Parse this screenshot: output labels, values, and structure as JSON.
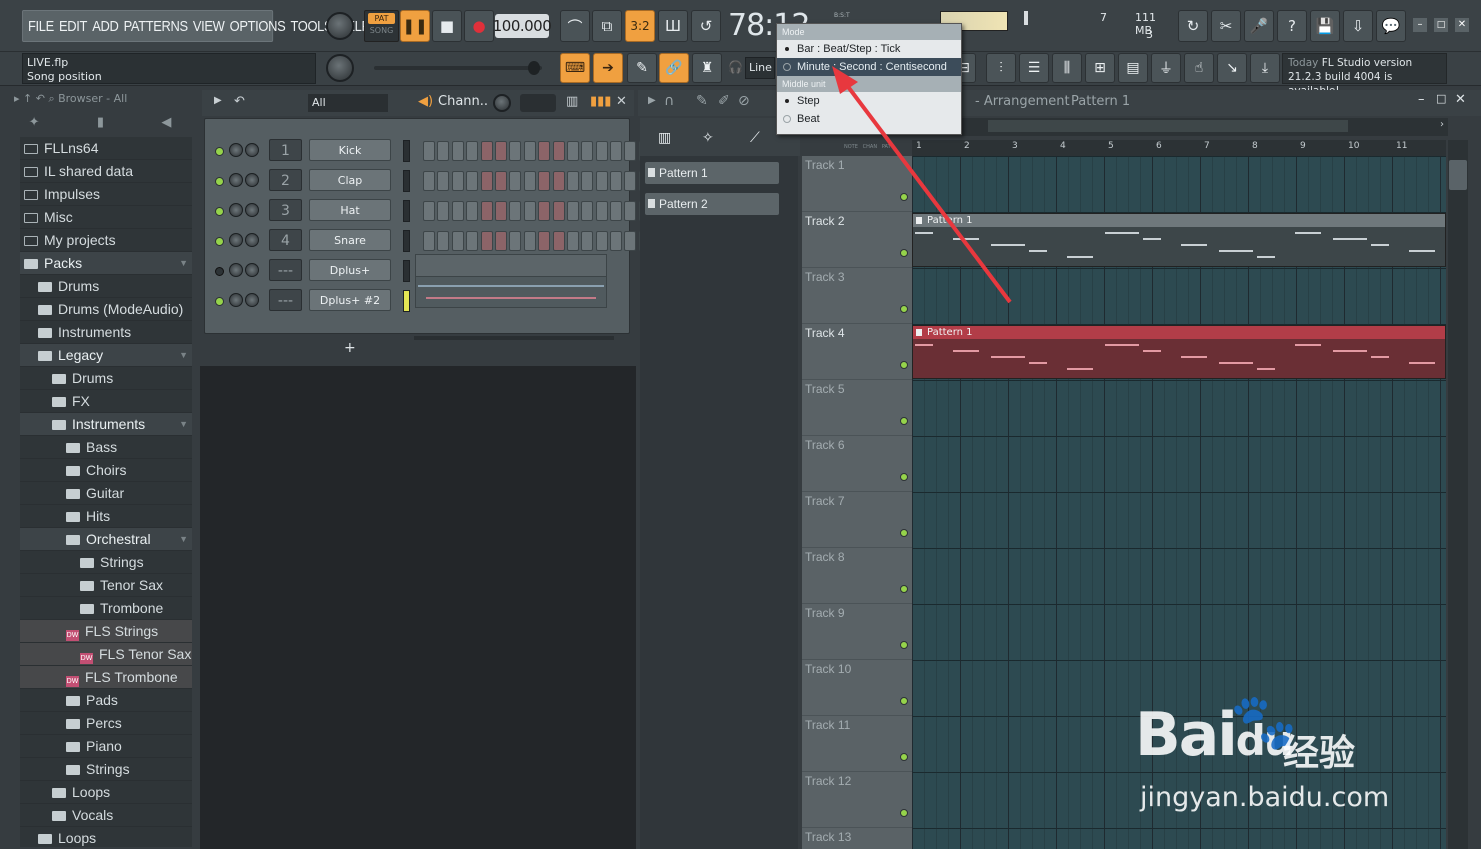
{
  "menu": [
    "FILE",
    "EDIT",
    "ADD",
    "PATTERNS",
    "VIEW",
    "OPTIONS",
    "TOOLS",
    "HELP"
  ],
  "transport": {
    "pat": "PAT",
    "song": "SONG",
    "tempo": "100.000",
    "time": "78:12",
    "bst": "B:S:T"
  },
  "status": {
    "cpu_left": "7",
    "memory": "111 MB",
    "poly": "3"
  },
  "hint": {
    "file": "LIVE.flp",
    "label": "Song position"
  },
  "snap": "Line",
  "news": {
    "today": "Today",
    "title": "FL Studio version",
    "body": "21.2.3 build 4004 is available!"
  },
  "browser": {
    "title": "Browser - All",
    "items": [
      {
        "label": "FLLns64",
        "icon": "folder-icon",
        "indent": 0
      },
      {
        "label": "IL shared data",
        "icon": "folder-icon",
        "indent": 0
      },
      {
        "label": "Impulses",
        "icon": "folder-icon",
        "indent": 0
      },
      {
        "label": "Misc",
        "icon": "folder-icon",
        "indent": 0
      },
      {
        "label": "My projects",
        "icon": "folder-icon",
        "indent": 0
      },
      {
        "label": "Packs",
        "icon": "pack-icon",
        "indent": 0
      },
      {
        "label": "Drums",
        "icon": "pack-icon",
        "indent": 1
      },
      {
        "label": "Drums (ModeAudio)",
        "icon": "pack-icon",
        "indent": 1
      },
      {
        "label": "Instruments",
        "icon": "pack-icon",
        "indent": 1
      },
      {
        "label": "Legacy",
        "icon": "pack-icon",
        "indent": 1
      },
      {
        "label": "Drums",
        "icon": "pack-icon",
        "indent": 2
      },
      {
        "label": "FX",
        "icon": "pack-icon",
        "indent": 2
      },
      {
        "label": "Instruments",
        "icon": "pack-icon",
        "indent": 2
      },
      {
        "label": "Bass",
        "icon": "pack-icon",
        "indent": 3
      },
      {
        "label": "Choirs",
        "icon": "pack-icon",
        "indent": 3
      },
      {
        "label": "Guitar",
        "icon": "pack-icon",
        "indent": 3
      },
      {
        "label": "Hits",
        "icon": "pack-icon",
        "indent": 3
      },
      {
        "label": "Orchestral",
        "icon": "pack-icon",
        "indent": 3
      },
      {
        "label": "Strings",
        "icon": "pack-icon",
        "indent": 4
      },
      {
        "label": "Tenor Sax",
        "icon": "pack-icon",
        "indent": 4
      },
      {
        "label": "Trombone",
        "icon": "pack-icon",
        "indent": 4
      },
      {
        "label": "FLS Strings",
        "icon": "dw-icon",
        "indent": 3
      },
      {
        "label": "FLS Tenor Sax",
        "icon": "dw-icon",
        "indent": 4
      },
      {
        "label": "FLS Trombone",
        "icon": "dw-icon",
        "indent": 3
      },
      {
        "label": "Pads",
        "icon": "pack-icon",
        "indent": 3
      },
      {
        "label": "Percs",
        "icon": "pack-icon",
        "indent": 3
      },
      {
        "label": "Piano",
        "icon": "pack-icon",
        "indent": 3
      },
      {
        "label": "Strings",
        "icon": "pack-icon",
        "indent": 3
      },
      {
        "label": "Loops",
        "icon": "pack-icon",
        "indent": 2
      },
      {
        "label": "Vocals",
        "icon": "pack-icon",
        "indent": 2
      },
      {
        "label": "Loops",
        "icon": "pack-icon",
        "indent": 1
      }
    ]
  },
  "channel_rack": {
    "filter": "All",
    "title": "Chann..",
    "add": "+",
    "channels": [
      {
        "num": "1",
        "name": "Kick",
        "active": true
      },
      {
        "num": "2",
        "name": "Clap",
        "active": true
      },
      {
        "num": "3",
        "name": "Hat",
        "active": true
      },
      {
        "num": "4",
        "name": "Snare",
        "active": true
      },
      {
        "num": "---",
        "name": "Dplus+",
        "active": false
      },
      {
        "num": "---",
        "name": "Dplus+ #2",
        "active": true
      }
    ]
  },
  "playlist": {
    "title": "- Arrangement",
    "pattern": "Pattern 1",
    "patterns": [
      "Pattern 1",
      "Pattern 2"
    ],
    "ruler_labels": [
      "1",
      "2",
      "3",
      "4",
      "5",
      "6",
      "7",
      "8",
      "9",
      "10",
      "11"
    ],
    "ruler_prefix": "NOTE   CHAN   PAT",
    "tracks": [
      "Track 1",
      "Track 2",
      "Track 3",
      "Track 4",
      "Track 5",
      "Track 6",
      "Track 7",
      "Track 8",
      "Track 9",
      "Track 10",
      "Track 11",
      "Track 12",
      "Track 13"
    ],
    "clips": [
      {
        "label": "Pattern 1",
        "track": 2,
        "color": "grey"
      },
      {
        "label": "Pattern 1",
        "track": 4,
        "color": "red"
      }
    ]
  },
  "popup": {
    "mode_label": "Mode",
    "options_mode": [
      "Bar : Beat/Step : Tick",
      "Minute : Second : Centisecond"
    ],
    "middle_label": "Middle unit",
    "options_middle": [
      "Step",
      "Beat"
    ]
  },
  "watermark": {
    "brand": "Bai",
    "suffix": "du",
    "cn": "经验",
    "url": "jingyan.baidu.com"
  }
}
